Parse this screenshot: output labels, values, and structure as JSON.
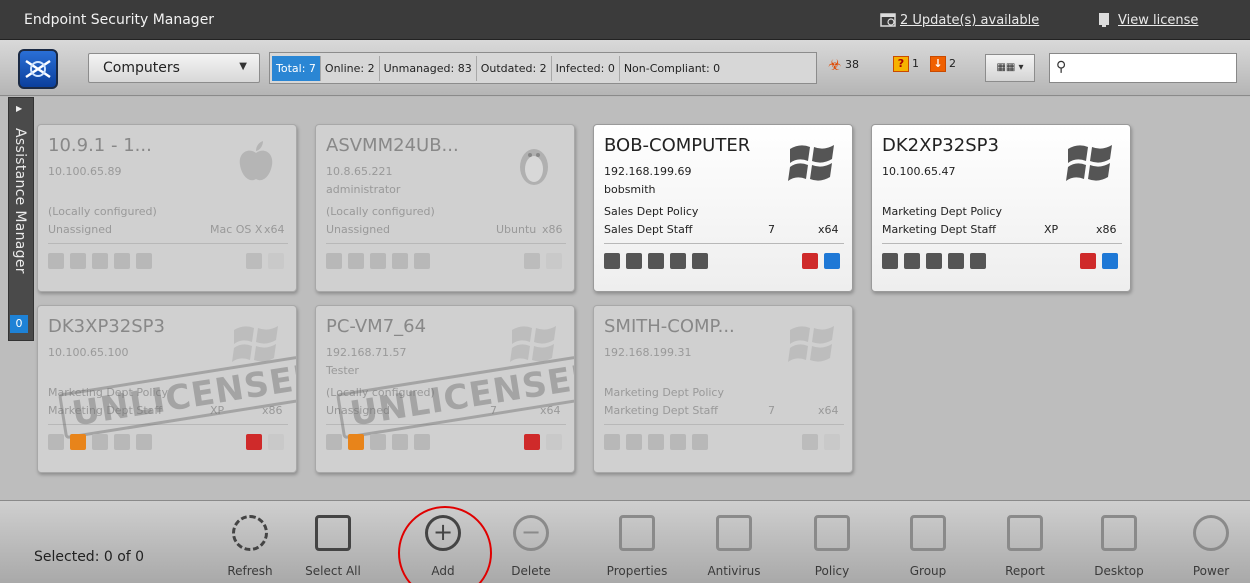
{
  "app": {
    "title": "Endpoint Security Manager"
  },
  "titlebar": {
    "updates": "2 Update(s) available",
    "license": "View license"
  },
  "toolbar": {
    "view": "Computers",
    "filters": [
      "Total: 7",
      "Online: 2",
      "Unmanaged: 83",
      "Outdated: 2",
      "Infected: 0",
      "Non-Compliant: 0"
    ],
    "alerts": {
      "viruses": "38",
      "questions": "1",
      "downloads": "2"
    },
    "search_value": ""
  },
  "assistance": {
    "label": "Assistance Manager",
    "count": "0"
  },
  "cards": [
    {
      "name": "10.9.1 - 1...",
      "ip": "10.100.65.89",
      "user": "",
      "policy": "(Locally configured)",
      "group": "Unassigned",
      "os": "Mac OS X",
      "arch": "x64",
      "status": "offline",
      "licensed": true
    },
    {
      "name": "ASVMM24UB...",
      "ip": "10.8.65.221",
      "user": "administrator",
      "policy": "(Locally configured)",
      "group": "Unassigned",
      "os": "Ubuntu",
      "arch": "x86",
      "status": "offline",
      "licensed": true
    },
    {
      "name": "BOB-COMPUTER",
      "ip": "192.168.199.69",
      "user": "bobsmith",
      "policy": "Sales Dept Policy",
      "group": "Sales Dept Staff",
      "os": "7",
      "arch": "x64",
      "status": "online",
      "licensed": true
    },
    {
      "name": "DK2XP32SP3",
      "ip": "10.100.65.47",
      "user": "",
      "policy": "Marketing Dept Policy",
      "group": "Marketing Dept Staff",
      "os": "XP",
      "arch": "x86",
      "status": "online",
      "licensed": true
    },
    {
      "name": "DK3XP32SP3",
      "ip": "10.100.65.100",
      "user": "",
      "policy": "Marketing Dept Policy",
      "group": "Marketing Dept Staff",
      "os": "XP",
      "arch": "x86",
      "status": "offline",
      "licensed": false
    },
    {
      "name": "PC-VM7_64",
      "ip": "192.168.71.57",
      "user": "Tester",
      "policy": "(Locally configured)",
      "group": "Unassigned",
      "os": "7",
      "arch": "x64",
      "status": "offline",
      "licensed": false
    },
    {
      "name": "SMITH-COMP...",
      "ip": "192.168.199.31",
      "user": "",
      "policy": "Marketing Dept Policy",
      "group": "Marketing Dept Staff",
      "os": "7",
      "arch": "x64",
      "status": "offline",
      "licensed": true
    }
  ],
  "stamp_text": "UNLICENSED",
  "bottom": {
    "selected": "Selected: 0 of 0",
    "actions": [
      "Refresh",
      "Select All",
      "Add",
      "Delete",
      "Properties",
      "Antivirus",
      "Policy",
      "Group",
      "Report",
      "Desktop",
      "Power"
    ]
  },
  "colors": {
    "accent": "#2a86d4",
    "titlebar": "#3b3b3b",
    "highlight_ring": "#e00000"
  }
}
